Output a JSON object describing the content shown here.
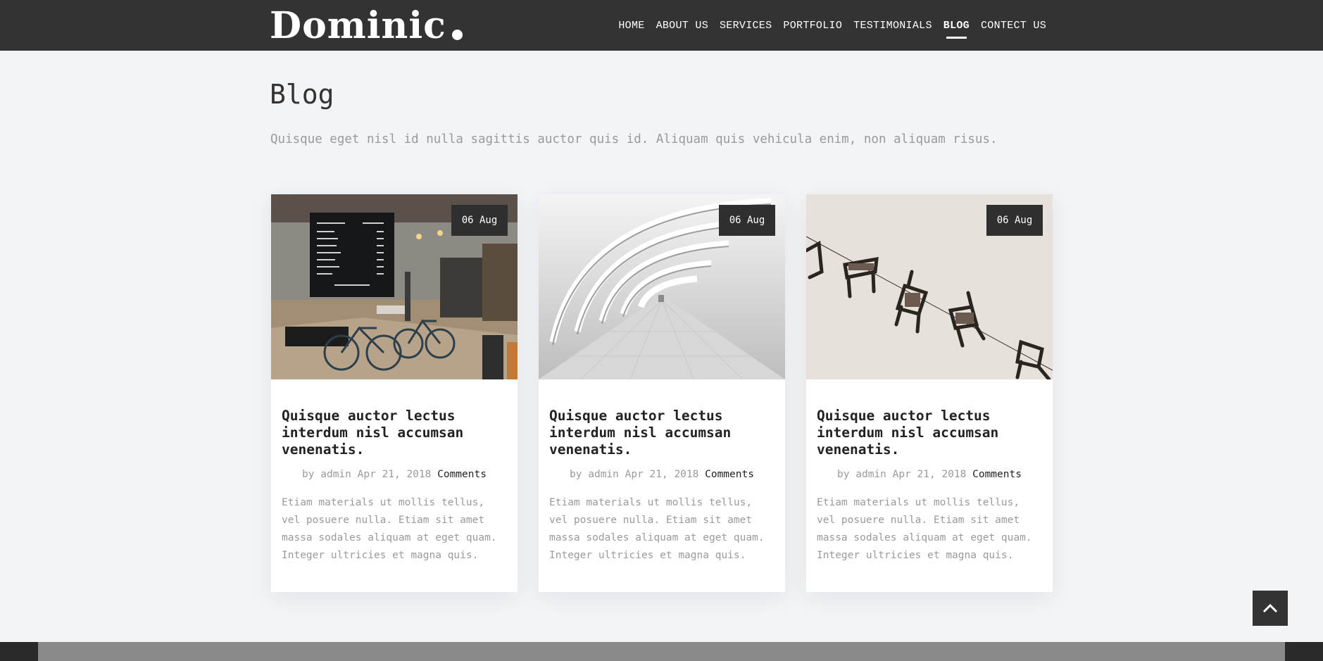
{
  "brand": {
    "logo_text": "Dominic"
  },
  "nav": {
    "items": [
      {
        "label": "HOME",
        "active": false
      },
      {
        "label": "ABOUT US",
        "active": false
      },
      {
        "label": "SERVICES",
        "active": false
      },
      {
        "label": "PORTFOLIO",
        "active": false
      },
      {
        "label": "TESTIMONIALS",
        "active": false
      },
      {
        "label": "BLOG",
        "active": true
      },
      {
        "label": "CONTECT US",
        "active": false
      }
    ]
  },
  "blog": {
    "title": "Blog",
    "subtitle": "Quisque eget nisl id nulla sagittis auctor quis id. Aliquam quis vehicula enim, non aliquam risus.",
    "posts": [
      {
        "date": "06 Aug",
        "title": "Quisque auctor lectus interdum nisl accumsan venenatis.",
        "meta_by": "by admin Apr 21, 2018",
        "comments_label": "Comments",
        "excerpt": "Etiam materials ut mollis tellus, vel posuere nulla. Etiam sit amet massa sodales aliquam at eget quam. Integer ultricies et magna quis.",
        "image_icon": "cafe-photo"
      },
      {
        "date": "06 Aug",
        "title": "Quisque auctor lectus interdum nisl accumsan venenatis.",
        "meta_by": "by admin Apr 21, 2018",
        "comments_label": "Comments",
        "excerpt": "Etiam materials ut mollis tellus, vel posuere nulla. Etiam sit amet massa sodales aliquam at eget quam. Integer ultricies et magna quis.",
        "image_icon": "architecture-photo"
      },
      {
        "date": "06 Aug",
        "title": "Quisque auctor lectus interdum nisl accumsan venenatis.",
        "meta_by": "by admin Apr 21, 2018",
        "comments_label": "Comments",
        "excerpt": "Etiam materials ut mollis tellus, vel posuere nulla. Etiam sit amet massa sodales aliquam at eget quam. Integer ultricies et magna quis.",
        "image_icon": "floating-chairs-photo"
      }
    ]
  },
  "scroll_top": {
    "icon": "chevron-up-icon"
  },
  "colors": {
    "navbar": "#333333",
    "page_bg": "#f3f4f6",
    "muted_text": "#9a9a9a"
  }
}
